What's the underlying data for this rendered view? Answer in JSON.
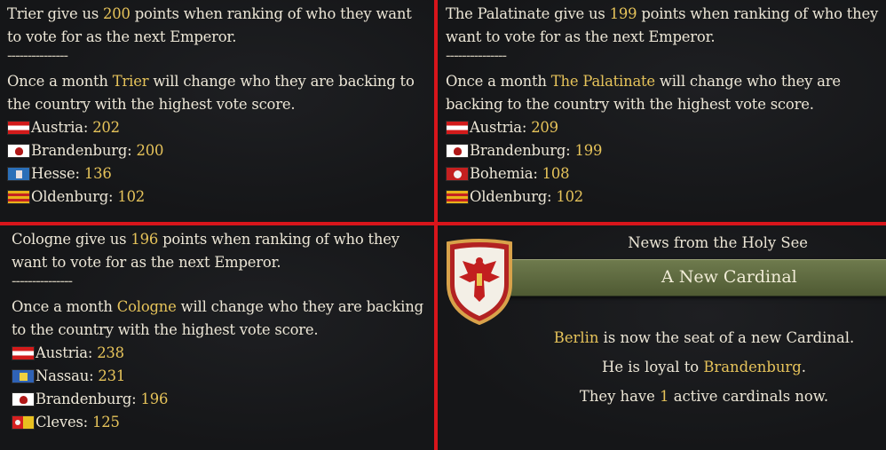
{
  "tooltips": [
    {
      "elector": "Trier",
      "points": "200",
      "intro_a": " give us ",
      "intro_b": " points when ranking of who they want to vote for as the next Emperor.",
      "separator": "---------------",
      "monthly_a": "Once a month ",
      "monthly_b": " will change who they are backing to the country with the highest vote score.",
      "scores": [
        {
          "flag": "austria-flag",
          "name": "Austria:",
          "score": "202"
        },
        {
          "flag": "brandenburg-flag",
          "name": "Brandenburg:",
          "score": "200"
        },
        {
          "flag": "hesse-flag",
          "name": "Hesse:",
          "score": "136"
        },
        {
          "flag": "oldenburg-flag",
          "name": "Oldenburg:",
          "score": "102"
        }
      ]
    },
    {
      "elector": "The Palatinate",
      "points": "199",
      "intro_a": " give us ",
      "intro_b": " points when ranking of who they want to vote for as the next Emperor.",
      "separator": "---------------",
      "monthly_a": "Once a month ",
      "monthly_b": " will change who they are backing to the country with the highest vote score.",
      "scores": [
        {
          "flag": "austria-flag",
          "name": "Austria:",
          "score": "209"
        },
        {
          "flag": "brandenburg-flag",
          "name": "Brandenburg:",
          "score": "199"
        },
        {
          "flag": "bohemia-flag",
          "name": "Bohemia:",
          "score": "108"
        },
        {
          "flag": "oldenburg-flag",
          "name": "Oldenburg:",
          "score": "102"
        }
      ]
    },
    {
      "elector": "Cologne",
      "points": "196",
      "intro_a": " give us ",
      "intro_b": " points when ranking of who they want to vote for as the next Emperor.",
      "separator": "---------------",
      "monthly_a": "Once a month ",
      "monthly_b": " will change who they are backing to the country with the highest vote score.",
      "scores": [
        {
          "flag": "austria-flag",
          "name": "Austria:",
          "score": "238"
        },
        {
          "flag": "nassau-flag",
          "name": "Nassau:",
          "score": "231"
        },
        {
          "flag": "brandenburg-flag",
          "name": "Brandenburg:",
          "score": "196"
        },
        {
          "flag": "cleves-flag",
          "name": "Cleves:",
          "score": "125"
        }
      ]
    }
  ],
  "news": {
    "header": "News from the Holy See",
    "title": "A New Cardinal",
    "emblem": "brandenburg-eagle-shield-icon",
    "line1_city": "Berlin",
    "line1_rest": " is now the seat of a new Cardinal.",
    "line2_a": "He is loyal to ",
    "line2_country": "Brandenburg",
    "line2_b": ".",
    "line3_a": "They have ",
    "line3_count": "1",
    "line3_b": " active cardinals now."
  },
  "colors": {
    "highlight": "#e6c35a",
    "divider": "#d8151b",
    "banner": "#5f6a3f"
  }
}
